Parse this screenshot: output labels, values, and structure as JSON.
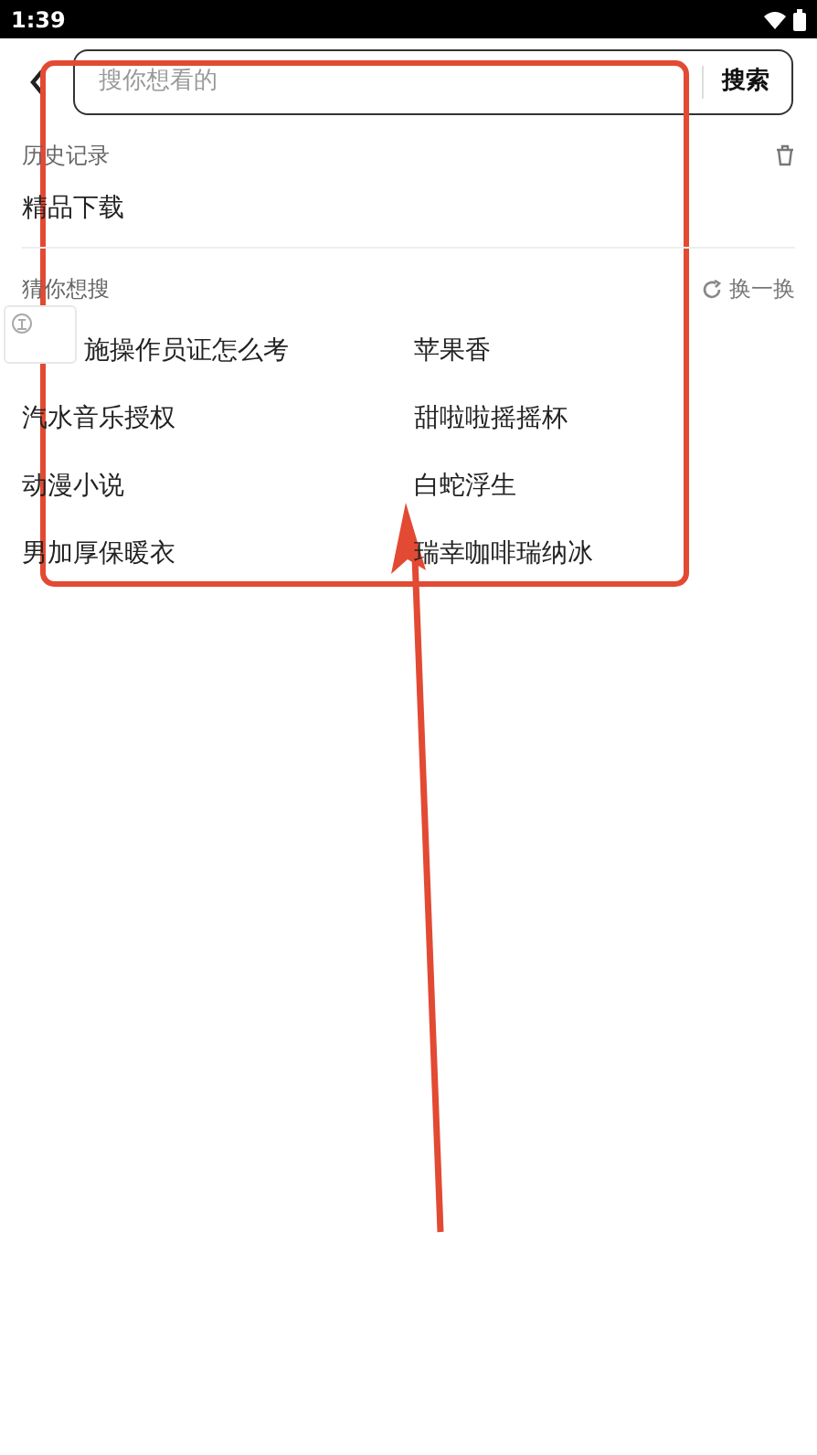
{
  "status_bar": {
    "time": "1:39"
  },
  "search": {
    "placeholder": "搜你想看的",
    "button": "搜索"
  },
  "history": {
    "title": "历史记录",
    "items": [
      "精品下载"
    ]
  },
  "suggestions": {
    "title": "猜你想搜",
    "refresh": "换一换",
    "items": [
      "施操作员证怎么考",
      "苹果香",
      "汽水音乐授权",
      "甜啦啦摇摇杯",
      "动漫小说",
      "白蛇浮生",
      "男加厚保暖衣",
      "瑞幸咖啡瑞纳冰"
    ]
  }
}
